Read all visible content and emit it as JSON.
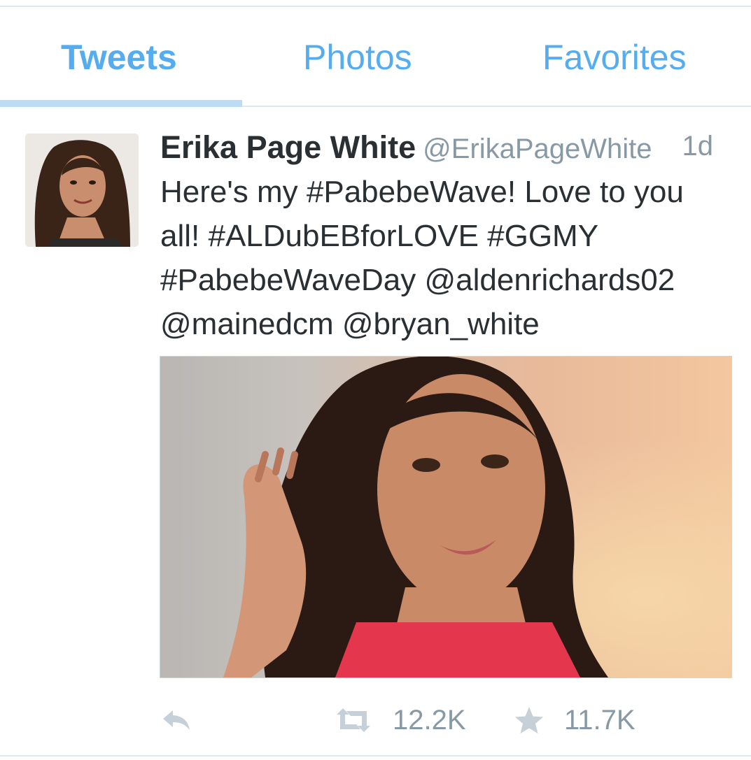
{
  "tabs": [
    {
      "label": "Tweets",
      "active": true
    },
    {
      "label": "Photos",
      "active": false
    },
    {
      "label": "Favorites",
      "active": false
    }
  ],
  "tweet": {
    "name": "Erika Page White",
    "handle": "@ErikaPageWhite",
    "time": "1d",
    "lines": [
      "Here's my #PabebeWave! Love to you",
      "all! #ALDubEBforLOVE #GGMY",
      "#PabebeWaveDay @aldenrichards02",
      "@mainedcm @bryan_white"
    ],
    "retweet_count": "12.2K",
    "favorite_count": "11.7K"
  },
  "icons": {
    "reply": "reply-icon",
    "retweet": "retweet-icon",
    "favorite": "star-icon"
  },
  "colors": {
    "accent": "#55acee",
    "text": "#292f33",
    "muted": "#8899a6",
    "icon": "#aab8c2"
  }
}
